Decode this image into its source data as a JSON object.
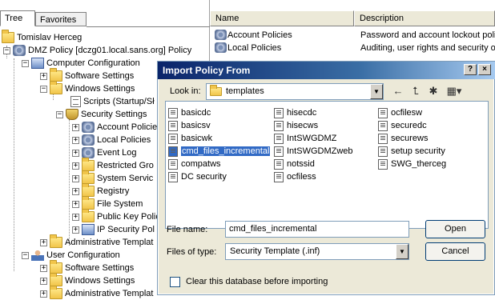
{
  "tabs": {
    "tree": "Tree",
    "favorites": "Favorites"
  },
  "tree": {
    "root": "Tomislav Herceg",
    "policy": "DMZ Policy [dczg01.local.sans.org] Policy",
    "computer_config": "Computer Configuration",
    "software_settings": "Software Settings",
    "windows_settings": "Windows Settings",
    "scripts": "Scripts (Startup/Sł",
    "security_settings": "Security Settings",
    "account_policies": "Account Policie",
    "local_policies": "Local Policies",
    "event_log": "Event Log",
    "restricted_groups": "Restricted Gro",
    "system_services": "System Servic",
    "registry": "Registry",
    "file_system": "File System",
    "public_key": "Public Key Polic",
    "ip_security": "IP Security Pol",
    "admin_templates": "Administrative Templat",
    "user_config": "User Configuration",
    "user_software": "Software Settings",
    "user_windows": "Windows Settings",
    "user_admin": "Administrative Templat"
  },
  "details": {
    "col_name": "Name",
    "col_description": "Description",
    "rows": [
      {
        "name": "Account Policies",
        "description": "Password and account lockout polici"
      },
      {
        "name": "Local Policies",
        "description": "Auditing, user rights and security op"
      }
    ]
  },
  "dialog": {
    "title": "Import Policy From",
    "help_btn": "?",
    "close_btn": "×",
    "look_in_label": "Look in:",
    "look_in_value": "templates",
    "files": [
      "basicdc",
      "basicsv",
      "basicwk",
      "cmd_files_incremental",
      "compatws",
      "DC security",
      "hisecdc",
      "hisecws",
      "IntSWGDMZ",
      "IntSWGDMZweb",
      "notssid",
      "ocfiless",
      "ocfilesw",
      "securedc",
      "securews",
      "setup security",
      "SWG_therceg"
    ],
    "selected_file": "cmd_files_incremental",
    "file_name_label": "File name:",
    "file_name_value": "cmd_files_incremental",
    "files_of_type_label": "Files of type:",
    "files_of_type_value": "Security Template (.inf)",
    "open_btn": "Open",
    "cancel_btn": "Cancel",
    "clear_db_label": "Clear this database before importing"
  }
}
